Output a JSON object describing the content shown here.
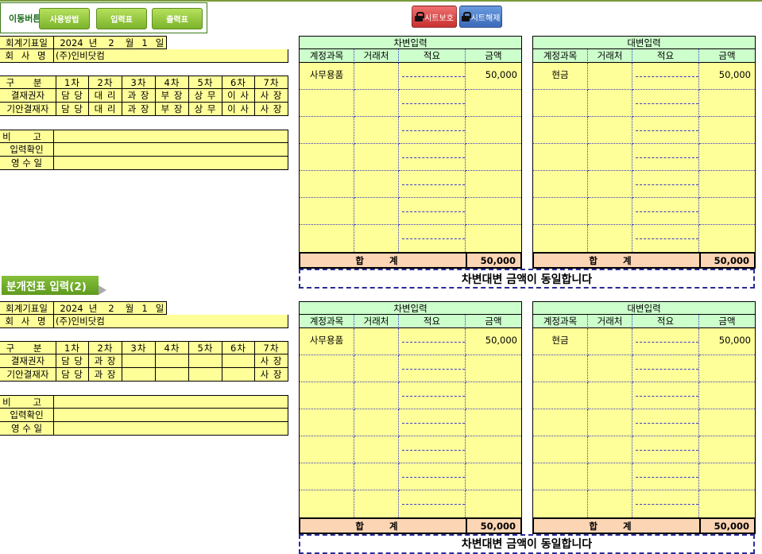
{
  "nav": {
    "title": "이동버튼",
    "buttons": [
      "사용방법",
      "입력표",
      "출력표"
    ],
    "protect_label": "시트보호",
    "unprotect_label": "시트해제"
  },
  "colors": {
    "header": "#ccffcc",
    "input": "#ffff99",
    "total": "#fcd5b4",
    "button_green": "#8cc63f",
    "protect_red": "#e05050",
    "unprotect_blue": "#4a7cc8"
  },
  "section2_title": "분개전표 입력(2)",
  "notice": "차변대변 금액이 동일합니다",
  "vouchers": [
    {
      "date_label": "회계기표일",
      "year": "2024",
      "year_unit": "년",
      "month": "2",
      "month_unit": "월",
      "day": "1",
      "day_unit": "일",
      "company_label": "회 사 명",
      "company": "(주)인비닷컴",
      "stage_label": "구 분",
      "stages": [
        "1차",
        "2차",
        "3차",
        "4차",
        "5차",
        "6차",
        "7차"
      ],
      "approver_label": "결재권자",
      "approvers": [
        "담 당",
        "대 리",
        "과 장",
        "부 장",
        "상 무",
        "이 사",
        "사 장"
      ],
      "drafter_label": "기안결재자",
      "drafters": [
        "담 당",
        "대 리",
        "과 장",
        "부 장",
        "상 무",
        "이 사",
        "사 장"
      ],
      "memo_label": "비 고",
      "confirm_label": "입력확인",
      "receipt_label": "영 수 일",
      "debit": {
        "title": "차변입력",
        "cols": [
          "계정과목",
          "거래처",
          "적요",
          "금액"
        ],
        "account": "사무용품",
        "amount": "50,000",
        "total_label": "합 계",
        "total": "50,000"
      },
      "credit": {
        "title": "대변입력",
        "cols": [
          "계정과목",
          "거래처",
          "적요",
          "금액"
        ],
        "account": "현금",
        "amount": "50,000",
        "total_label": "합 계",
        "total": "50,000"
      }
    },
    {
      "date_label": "회계기표일",
      "year": "2024",
      "year_unit": "년",
      "month": "2",
      "month_unit": "월",
      "day": "1",
      "day_unit": "일",
      "company_label": "회 사 명",
      "company": "(주)인비닷컴",
      "stage_label": "구 분",
      "stages": [
        "1차",
        "2차",
        "3차",
        "4차",
        "5차",
        "6차",
        "7차"
      ],
      "approver_label": "결재권자",
      "approvers": [
        "담 당",
        "과 장",
        "",
        "",
        "",
        "",
        "사 장"
      ],
      "drafter_label": "기안결재자",
      "drafters": [
        "담 당",
        "과 장",
        "",
        "",
        "",
        "",
        "사 장"
      ],
      "memo_label": "비 고",
      "confirm_label": "입력확인",
      "receipt_label": "영 수 일",
      "debit": {
        "title": "차변입력",
        "cols": [
          "계정과목",
          "거래처",
          "적요",
          "금액"
        ],
        "account": "사무용품",
        "amount": "50,000",
        "total_label": "합 계",
        "total": "50,000"
      },
      "credit": {
        "title": "대변입력",
        "cols": [
          "계정과목",
          "거래처",
          "적요",
          "금액"
        ],
        "account": "현금",
        "amount": "50,000",
        "total_label": "합 계",
        "total": "50,000"
      }
    }
  ]
}
